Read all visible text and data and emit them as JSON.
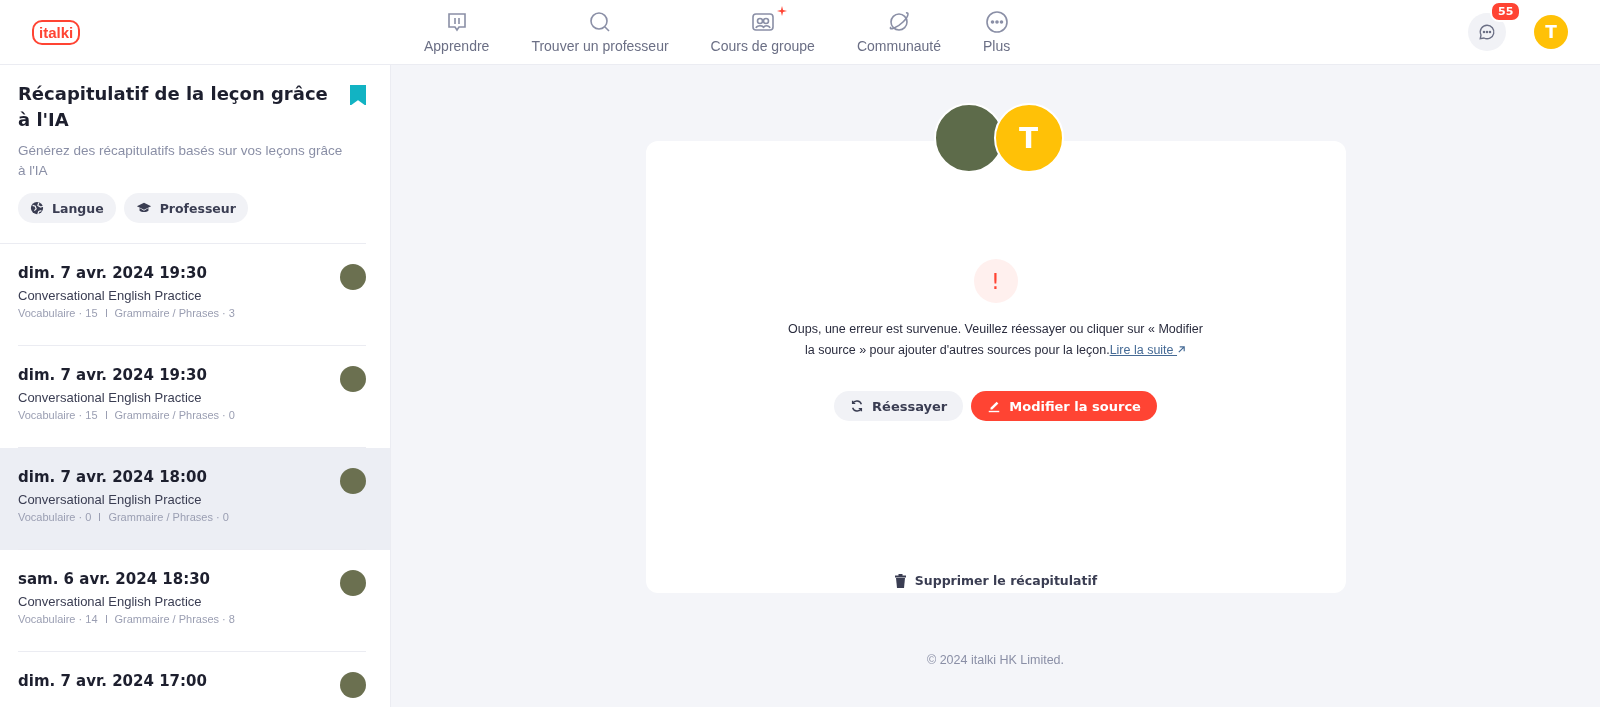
{
  "header": {
    "logo": "italki",
    "nav": [
      {
        "label": "Apprendre"
      },
      {
        "label": "Trouver un professeur"
      },
      {
        "label": "Cours de groupe"
      },
      {
        "label": "Communauté"
      },
      {
        "label": "Plus"
      }
    ],
    "messages_badge": "55",
    "user_initial": "T"
  },
  "sidebar": {
    "title": "Récapitulatif de la leçon grâce à l'IA",
    "subtitle": "Générez des récapitulatifs basés sur vos leçons grâce à l'IA",
    "bookmarked": true,
    "filters": [
      {
        "label": "Langue"
      },
      {
        "label": "Professeur"
      }
    ],
    "lessons": [
      {
        "date": "dim. 7 avr. 2024 19:30",
        "title": "Conversational English Practice",
        "vocabulary": "Vocabulaire · 15",
        "grammar": "Grammaire / Phrases · 3",
        "selected": false
      },
      {
        "date": "dim. 7 avr. 2024 19:30",
        "title": "Conversational English Practice",
        "vocabulary": "Vocabulaire · 15",
        "grammar": "Grammaire / Phrases · 0",
        "selected": false
      },
      {
        "date": "dim. 7 avr. 2024 18:00",
        "title": "Conversational English Practice",
        "vocabulary": "Vocabulaire · 0",
        "grammar": "Grammaire / Phrases · 0",
        "selected": true
      },
      {
        "date": "sam. 6 avr. 2024 18:30",
        "title": "Conversational English Practice",
        "vocabulary": "Vocabulaire · 14",
        "grammar": "Grammaire / Phrases · 8",
        "selected": false
      },
      {
        "date": "dim. 7 avr. 2024 17:00",
        "selected": false
      }
    ]
  },
  "main": {
    "student_initial": "T",
    "error_symbol": "!",
    "message": "Oups, une erreur est survenue. Veuillez réessayer ou cliquer sur « Modifier la source » pour ajouter d'autres sources pour la leçon.",
    "link": "Lire la suite",
    "retry": "Réessayer",
    "edit": "Modifier la source",
    "delete": "Supprimer le récapitulatif"
  },
  "footer": "© 2024 italki HK Limited."
}
